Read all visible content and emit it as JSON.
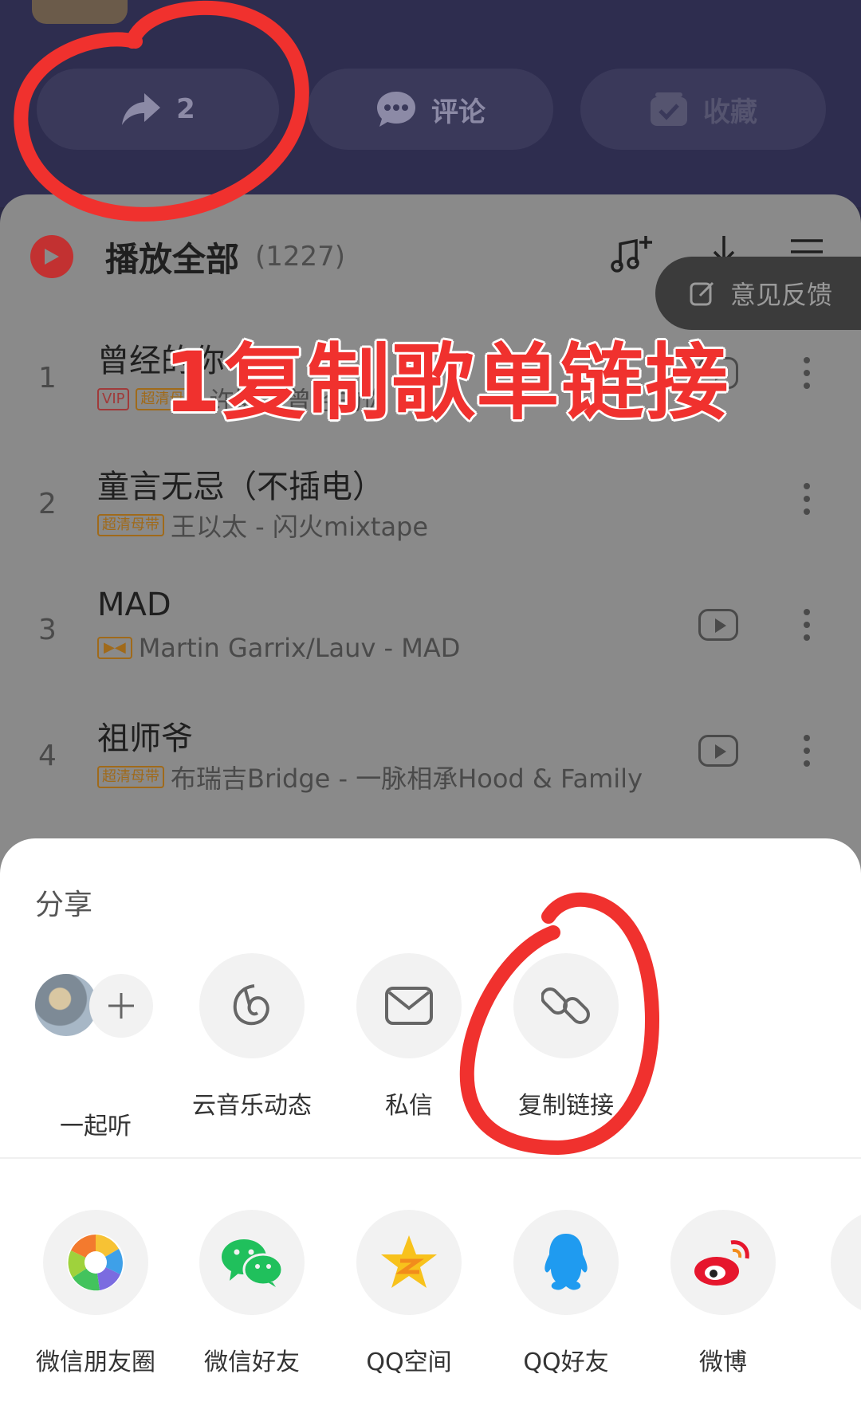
{
  "header": {
    "share_count": "2",
    "comment_label": "评论",
    "collect_label": "收藏"
  },
  "playlist": {
    "play_all_label": "播放全部",
    "count": "(1227)",
    "feedback_label": "意见反馈",
    "songs": [
      {
        "index": "1",
        "title": "曾经的你",
        "tags": [
          "VIP",
          "超清母带"
        ],
        "subtitle": "许巍 - 曾经的你"
      },
      {
        "index": "2",
        "title": "童言无忌（不插电）",
        "tags": [
          "超清母带"
        ],
        "subtitle": "王以太 - 闪火mixtape"
      },
      {
        "index": "3",
        "title": "MAD",
        "tags": [],
        "subtitle": "Martin Garrix/Lauv - MAD"
      },
      {
        "index": "4",
        "title": "祖师爷",
        "tags": [
          "超清母带"
        ],
        "subtitle": "布瑞吉Bridge - 一脉相承Hood & Family"
      }
    ]
  },
  "annotation": {
    "overlay_text": "1复制歌单链接",
    "color": "#f0312e"
  },
  "share": {
    "title": "分享",
    "row1": [
      {
        "label": "一起听",
        "icon": "plus-icon"
      },
      {
        "label": "云音乐动态",
        "icon": "netease-icon"
      },
      {
        "label": "私信",
        "icon": "mail-icon"
      },
      {
        "label": "复制链接",
        "icon": "link-icon"
      }
    ],
    "row2": [
      {
        "label": "微信朋友圈",
        "icon": "moments-icon"
      },
      {
        "label": "微信好友",
        "icon": "wechat-icon"
      },
      {
        "label": "QQ空间",
        "icon": "qzone-icon"
      },
      {
        "label": "QQ好友",
        "icon": "qq-icon"
      },
      {
        "label": "微博",
        "icon": "weibo-icon"
      }
    ]
  }
}
